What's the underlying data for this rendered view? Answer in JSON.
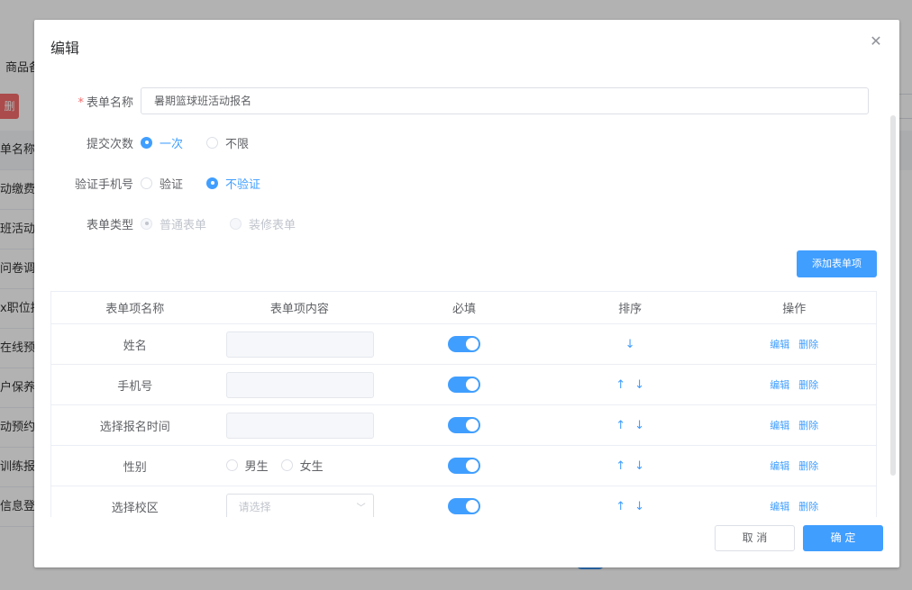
{
  "background": {
    "tab_label": "商品备",
    "delete_label": "删",
    "rows": [
      "单名称",
      "动缴费",
      "班活动",
      "问卷调研",
      "x职位招",
      "在线预约",
      "户保养预",
      "动预约报",
      "训练报名",
      "信息登"
    ]
  },
  "dialog": {
    "title": "编辑",
    "close_icon": "close-icon"
  },
  "form": {
    "name_label": "表单名称",
    "name_required_mark": "*",
    "name_value": "暑期篮球班活动报名",
    "submit_label": "提交次数",
    "submit_options": [
      "一次",
      "不限"
    ],
    "submit_selected": "一次",
    "verify_label": "验证手机号",
    "verify_options": [
      "验证",
      "不验证"
    ],
    "verify_selected": "不验证",
    "type_label": "表单类型",
    "type_options": [
      "普通表单",
      "装修表单"
    ],
    "type_selected": "普通表单"
  },
  "add_button_label": "添加表单项",
  "table": {
    "headers": [
      "表单项名称",
      "表单项内容",
      "必填",
      "排序",
      "操作"
    ],
    "rows": [
      {
        "name": "姓名",
        "content_kind": "input",
        "required": true,
        "up": false,
        "down": true
      },
      {
        "name": "手机号",
        "content_kind": "input",
        "required": true,
        "up": true,
        "down": true
      },
      {
        "name": "选择报名时间",
        "content_kind": "input",
        "required": true,
        "up": true,
        "down": true
      },
      {
        "name": "性别",
        "content_kind": "radio",
        "radio_options": [
          "男生",
          "女生"
        ],
        "required": true,
        "up": true,
        "down": true
      },
      {
        "name": "选择校区",
        "content_kind": "select",
        "select_placeholder": "请选择",
        "required": true,
        "up": true,
        "down": true
      }
    ],
    "edit_label": "编辑",
    "delete_label": "删除",
    "up_arrow": "↑",
    "down_arrow": "↓"
  },
  "footer": {
    "cancel_label": "取 消",
    "ok_label": "确 定"
  },
  "colors": {
    "primary": "#409eff",
    "danger": "#f56c6c"
  }
}
